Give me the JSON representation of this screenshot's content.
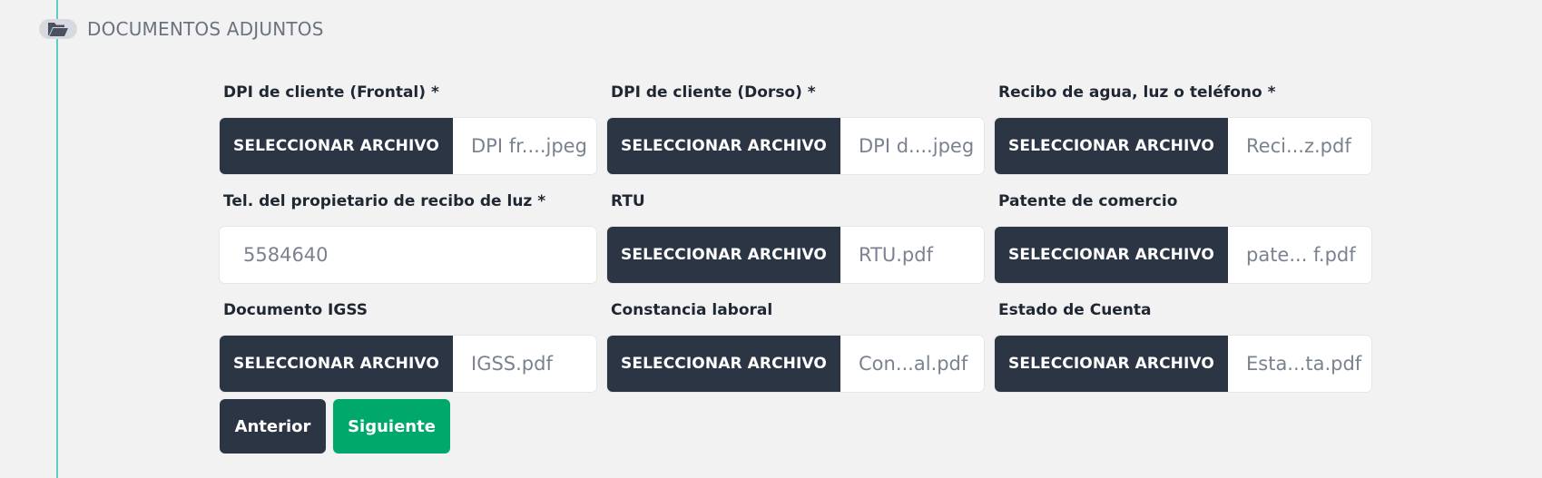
{
  "section": {
    "title": "DOCUMENTOS ADJUNTOS",
    "icon": "folder-open-icon"
  },
  "fields": [
    {
      "label": "DPI de cliente (Frontal) *",
      "button": "SELECCIONAR ARCHIVO",
      "file": "DPI fr....jpeg"
    },
    {
      "label": "DPI de cliente (Dorso) *",
      "button": "SELECCIONAR ARCHIVO",
      "file": "DPI d....jpeg"
    },
    {
      "label": "Recibo de agua, luz o teléfono *",
      "button": "SELECCIONAR ARCHIVO",
      "file": "Reci...z.pdf"
    },
    {
      "label": "Tel. del propietario de recibo de luz *",
      "value": "5584640"
    },
    {
      "label": "RTU",
      "button": "SELECCIONAR ARCHIVO",
      "file": "RTU.pdf"
    },
    {
      "label": "Patente de comercio",
      "button": "SELECCIONAR ARCHIVO",
      "file": "pate... f.pdf"
    },
    {
      "label": "Documento IGSS",
      "button": "SELECCIONAR ARCHIVO",
      "file": "IGSS.pdf"
    },
    {
      "label": "Constancia laboral",
      "button": "SELECCIONAR ARCHIVO",
      "file": "Con...al.pdf"
    },
    {
      "label": "Estado de Cuenta",
      "button": "SELECCIONAR ARCHIVO",
      "file": "Esta...ta.pdf"
    }
  ],
  "buttons": {
    "previous": "Anterior",
    "next": "Siguiente"
  },
  "colors": {
    "dark_button": "#2b3544",
    "primary_button": "#00a86b",
    "timeline_line": "#5ccfc0",
    "background": "#f2f2f2"
  }
}
